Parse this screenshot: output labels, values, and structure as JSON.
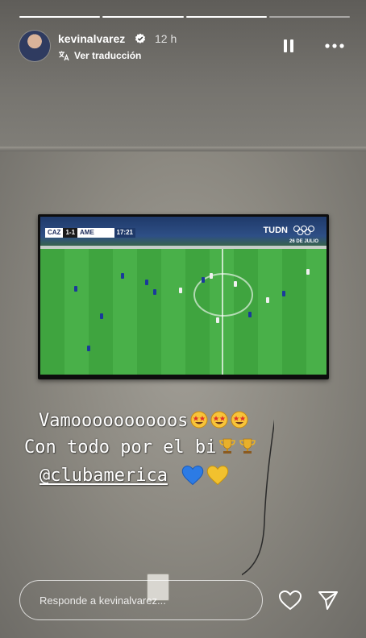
{
  "story": {
    "progress_segments": 4,
    "progress_done": 3,
    "user": {
      "username": "kevinalvarez",
      "verified": true,
      "time_ago": "12 h",
      "translate_label": "Ver traducción"
    },
    "caption": {
      "line1": "Vamoooooooooos",
      "line2": "Con todo por el bi",
      "line3": "@clubamerica",
      "line1_emojis": [
        "star-struck-emoji",
        "star-struck-emoji",
        "star-struck-emoji"
      ],
      "line2_emojis": [
        "trophy-emoji",
        "trophy-emoji"
      ],
      "line3_emojis": [
        "blue-heart-emoji",
        "yellow-heart-emoji"
      ]
    },
    "tv": {
      "broadcaster": "TUDN",
      "team_home": "CAZ",
      "team_away": "AME",
      "score": "1-1",
      "clock": "17:21",
      "date": "26 DE JULIO"
    }
  },
  "footer": {
    "reply_placeholder": "Responde a kevinalvarez..."
  },
  "icons": {
    "pause": "pause-icon",
    "more": "more-options-icon",
    "like": "heart-icon",
    "share": "send-icon",
    "verified": "verified-badge-icon"
  },
  "colors": {
    "verified_badge": "#ffffff",
    "field_green": "#45aa45",
    "text": "#ffffff"
  }
}
